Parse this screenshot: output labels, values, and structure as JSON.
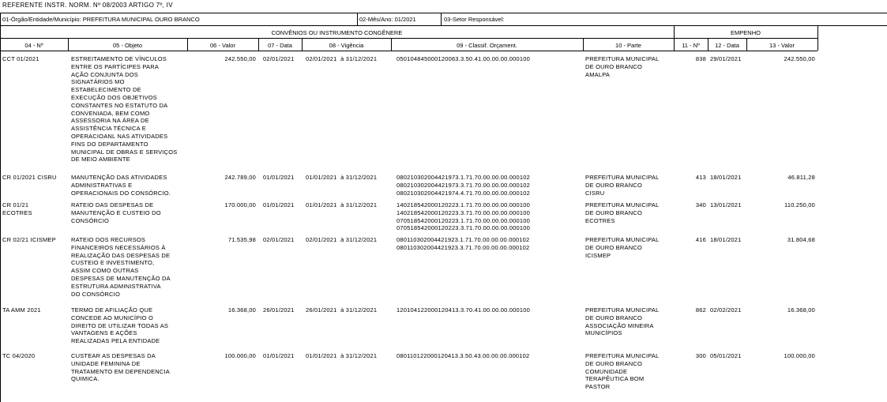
{
  "title": "REFERENTE INSTR. NORM. Nº 08/2003 ARTIGO 7º, IV",
  "info": {
    "orgao": "01-Órgão/Entidade/Município: PREFEITURA MUNICIPAL OURO BRANCO",
    "mes_ano": "02-Mês/Ano: 01/2021",
    "setor": "03-Setor Responsável:"
  },
  "group_headers": {
    "convenios": "CONVÊNIOS OU INSTRUMENTO CONGÊNERE",
    "empenho": "EMPENHO"
  },
  "columns": [
    "04 - Nº",
    "05 - Objeto",
    "06 - Valor",
    "07 - Data",
    "08 - Vigência",
    "09 - Classif. Orçament.",
    "10 - Parte",
    "11 - Nº",
    "12 - Data",
    "13 - Valor"
  ],
  "rows": [
    {
      "num": "CCT 01/2021",
      "objeto": "ESTREITAMENTO DE VÍNCULOS\nENTRE OS PARTÍCIPES PARA\nAÇÃO CONJUNTA DOS\nSIGNATÁRIOS MO\nESTABELECIMENTO DE\nEXECUÇÃO DOS OBJETIVOS\nCONSTANTES NO ESTATUTO DA\nCONVENIADA, BEM COMO\nASSESSORIA NA ÁREA DE\nASSISTÊNCIA TÉCNICA E\nOPERACIOANL NAS ATIVIDADES\nFINS DO DEPARTAMENTO\nMUNICIPAL DE OBRAS E SERVIÇOS\nDE MEIO AMBIENTE",
      "valor": "242.550,00",
      "data": "02/01/2021",
      "vigencia": "02/01/2021  à 31/12/2021",
      "classif": "050104845000120063.3.50.41.00.00.00.000100",
      "parte": "PREFEITURA MUNICIPAL\nDE OURO BRANCO\nAMALPA",
      "emp_num": "838",
      "emp_data": "29/01/2021",
      "emp_valor": "242.550,00"
    },
    {
      "num": "CR 01/2021 CISRU",
      "objeto": "MANUTENÇÃO DAS ATIVIDADES\nADMINISTRATIVAS E\nOPERACIONAIS DO CONSÓRCIO.",
      "valor": "242.789,00",
      "data": "01/01/2021",
      "vigencia": "01/01/2021  à 31/12/2021",
      "classif": "080210302004421973.1.71.70.00.00.00.000102\n080210302004421973.3.71.70.00.00.00.000102\n080210302004421974.4.71.70.00.00.00.000102",
      "parte": "PREFEITURA MUNICIPAL\nDE OURO BRANCO\nCISRU",
      "emp_num": "413",
      "emp_data": "18/01/2021",
      "emp_valor": "46.811,28"
    },
    {
      "num": "CR 01/21\nECOTRES",
      "objeto": "RATEIO DAS DESPESAS DE\nMANUTENÇÃO E CUSTEIO DO\nCONSÓRCIO",
      "valor": "170.000,00",
      "data": "01/01/2021",
      "vigencia": "01/01/2021  à 31/12/2021",
      "classif": "140218542000120223.1.71.70.00.00.00.000100\n140218542000120223.3.71.70.00.00.00.000100\n070518542000120223.1.71.70.00.00.00.000100\n070518542000120223.3.71.70.00.00.00.000100",
      "parte": "PREFEITURA MUNICIPAL\nDE OURO BRANCO\nECOTRES",
      "emp_num": "340",
      "emp_data": "13/01/2021",
      "emp_valor": "110.250,00"
    },
    {
      "num": "CR 02/21 ICISMEP",
      "objeto": "RATEIO DOS RECURSOS\nFINANCEIROS NECESSÁRIOS À\nREALIZAÇÃO DAS DESPESAS DE\nCUSTEIO E INVESTIMENTO,\nASSIM COMO OUTRAS\nDESPESAS DE MANUTENÇÃO DA\nESTRUTURA ADMINISTRATIVA\nDO CONSÓRCIO",
      "valor": "71.535,98",
      "data": "02/01/2021",
      "vigencia": "02/01/2021  à 31/12/2021",
      "classif": "080110302004421923.1.71.70.00.00.00.000102\n080110302004421923.3.71.70.00.00.00.000102",
      "parte": "PREFEITURA MUNICIPAL\nDE OURO BRANCO\nICISMEP",
      "emp_num": "416",
      "emp_data": "18/01/2021",
      "emp_valor": "31.804,68"
    },
    {
      "num": "TA AMM 2021",
      "objeto": "TERMO DE AFILIAÇÃO QUE\nCONCEDE AO MUNICÍPIO O\nDIREITO DE UTILIZAR TODAS AS\nVANTAGENS E AÇÕES\nREALIZADAS PELA ENTIDADE",
      "valor": "16.368,00",
      "data": "26/01/2021",
      "vigencia": "26/01/2021  à 31/12/2021",
      "classif": "120104122000120413.3.70.41.00.00.00.000100",
      "parte": "PREFEITURA MUNICIPAL\nDE OURO BRANCO\nASSOCIAÇÃO MINEIRA\nMUNICÍPIOS",
      "emp_num": "862",
      "emp_data": "02/02/2021",
      "emp_valor": "16.368,00"
    },
    {
      "num": "TC 04/2020",
      "objeto": "CUSTEAR AS DESPESAS DA\nUNIDADE FEMININA DE\nTRATAMENTO EM DEPENDENCIA\nQUIMICA.",
      "valor": "100.000,00",
      "data": "01/01/2021",
      "vigencia": "01/01/2021  à 31/12/2021",
      "classif": "080110122000120413.3.50.43.00.00.00.000102",
      "parte": "PREFEITURA MUNICIPAL\nDE OURO BRANCO\nCOMUNIDADE\nTERAPÊUTICA BOM\nPASTOR",
      "emp_num": "300",
      "emp_data": "05/01/2021",
      "emp_valor": "100.000,00"
    }
  ]
}
